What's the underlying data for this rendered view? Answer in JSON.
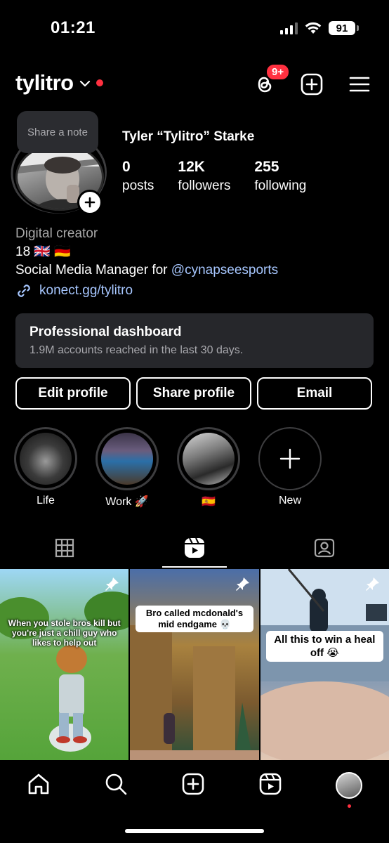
{
  "status_bar": {
    "time": "01:21",
    "battery": "91"
  },
  "header": {
    "username": "tylitro",
    "threads_badge": "9+"
  },
  "profile": {
    "note_placeholder": "Share a note",
    "full_name": "Tyler “Tylitro” Starke",
    "stats": [
      {
        "value": "0",
        "label": "posts"
      },
      {
        "value": "12K",
        "label": "followers"
      },
      {
        "value": "255",
        "label": "following"
      }
    ],
    "category": "Digital creator",
    "bio_line1": "18 🇬🇧 🇩🇪",
    "bio_line2_prefix": "Social Media Manager for ",
    "bio_mention": "@cynapseesports",
    "link": "konect.gg/tylitro"
  },
  "dashboard": {
    "title": "Professional dashboard",
    "subtitle": "1.9M accounts reached in the last 30 days."
  },
  "buttons": {
    "edit": "Edit profile",
    "share": "Share profile",
    "email": "Email"
  },
  "highlights": [
    {
      "label": "Life"
    },
    {
      "label": "Work 🚀"
    },
    {
      "label": "🇪🇸"
    },
    {
      "label": "New"
    }
  ],
  "reels": [
    {
      "caption": "When you stole bros kill but you're just a chill guy who likes to help out"
    },
    {
      "caption": "Bro called mcdonald's mid endgame 💀"
    },
    {
      "caption": "All this to win a heal off 😭"
    }
  ],
  "colors": {
    "accent_link": "#a7c7ff",
    "badge_red": "#ff3040",
    "card_bg": "#26272b"
  }
}
